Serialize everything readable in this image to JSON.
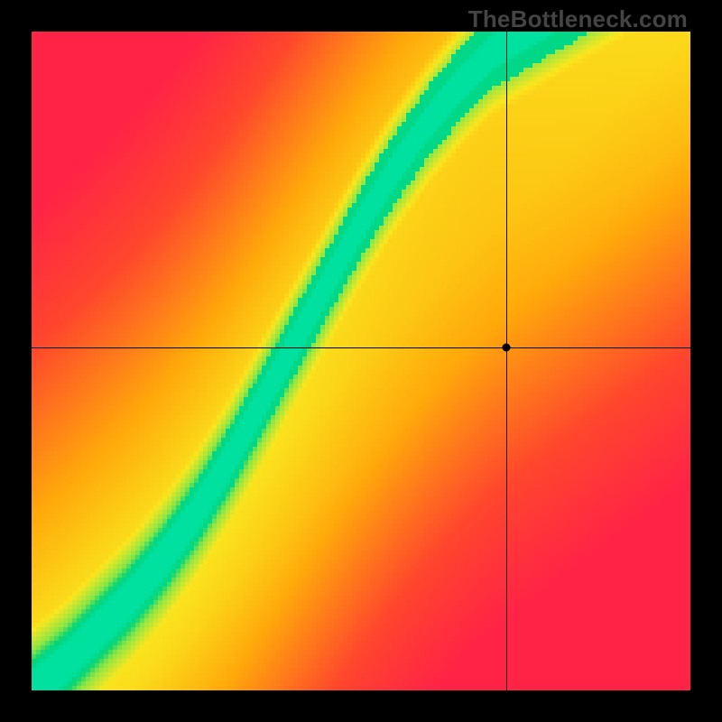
{
  "watermark": "TheBottleneck.com",
  "chart_data": {
    "type": "heatmap",
    "title": "",
    "xlabel": "",
    "ylabel": "",
    "xlim": [
      0,
      1
    ],
    "ylim": [
      0,
      1
    ],
    "crosshair": {
      "x": 0.72,
      "y": 0.52
    },
    "dot_radius_px": 4.5,
    "ridge_curve": [
      {
        "x": 0.0,
        "y": 0.0
      },
      {
        "x": 0.05,
        "y": 0.04
      },
      {
        "x": 0.1,
        "y": 0.09
      },
      {
        "x": 0.15,
        "y": 0.14
      },
      {
        "x": 0.2,
        "y": 0.2
      },
      {
        "x": 0.25,
        "y": 0.27
      },
      {
        "x": 0.3,
        "y": 0.35
      },
      {
        "x": 0.35,
        "y": 0.44
      },
      {
        "x": 0.4,
        "y": 0.53
      },
      {
        "x": 0.45,
        "y": 0.62
      },
      {
        "x": 0.5,
        "y": 0.71
      },
      {
        "x": 0.55,
        "y": 0.79
      },
      {
        "x": 0.6,
        "y": 0.86
      },
      {
        "x": 0.65,
        "y": 0.92
      },
      {
        "x": 0.7,
        "y": 0.97
      },
      {
        "x": 0.75,
        "y": 1.0
      }
    ],
    "ridge_halfwidth": 0.045,
    "colormap": "red-yellow-green-cyan",
    "pixelated": true,
    "grid": false,
    "legend": false
  }
}
